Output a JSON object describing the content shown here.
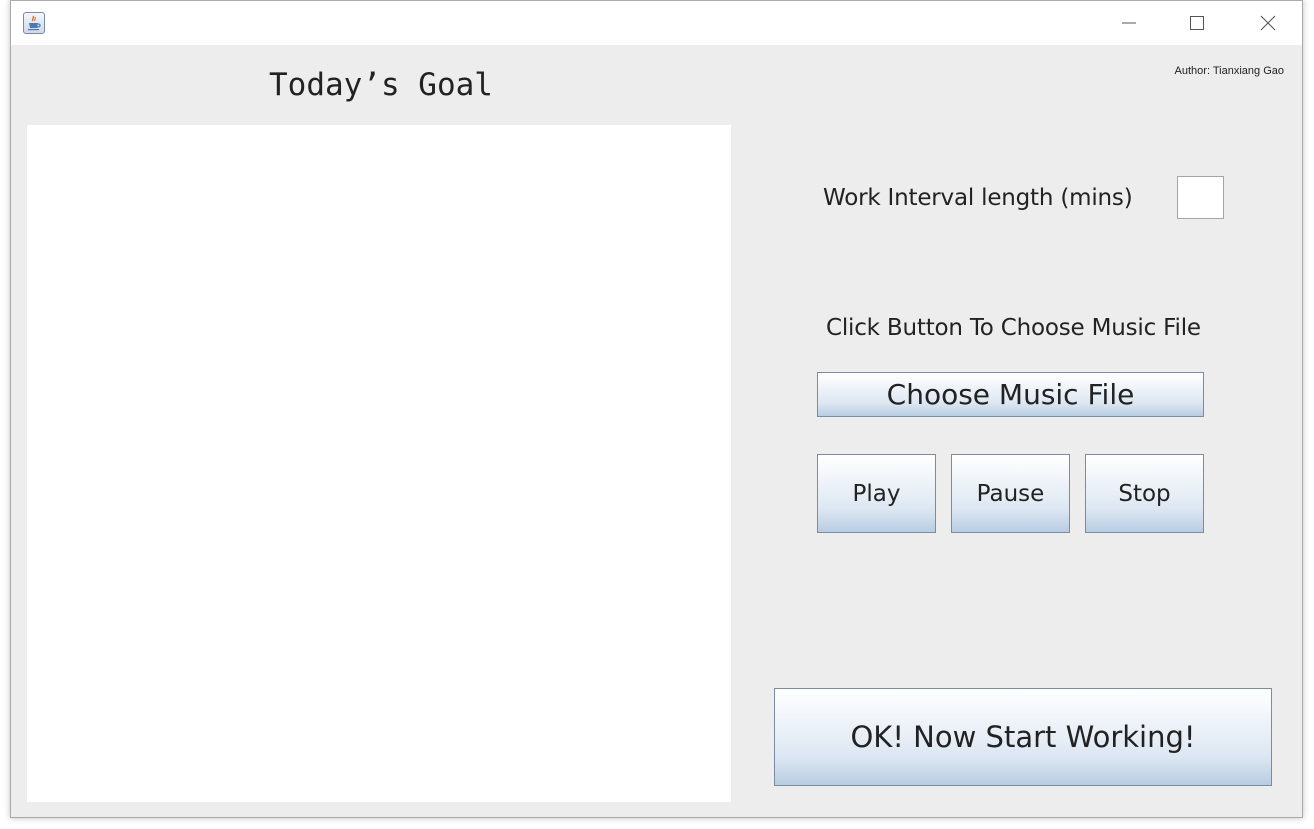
{
  "window": {
    "app_icon": "java-coffee-cup-icon",
    "controls": {
      "minimize_icon": "minimize-icon",
      "maximize_icon": "maximize-icon",
      "close_icon": "close-icon"
    }
  },
  "header": {
    "goal_title": "Today’s Goal",
    "author": "Author: Tianxiang Gao"
  },
  "goal_area": {
    "value": ""
  },
  "settings": {
    "interval_label": "Work Interval length (mins)",
    "interval_value": "",
    "music_label": "Click Button To Choose Music File",
    "choose_button": "Choose Music File",
    "play_button": "Play",
    "pause_button": "Pause",
    "stop_button": "Stop",
    "start_button": "OK! Now Start Working!"
  },
  "colors": {
    "window_background": "#ededed",
    "button_border": "#7a8ca5",
    "button_gradient_top": "#ffffff",
    "button_gradient_bottom": "#b8cde2",
    "text": "#222222"
  }
}
